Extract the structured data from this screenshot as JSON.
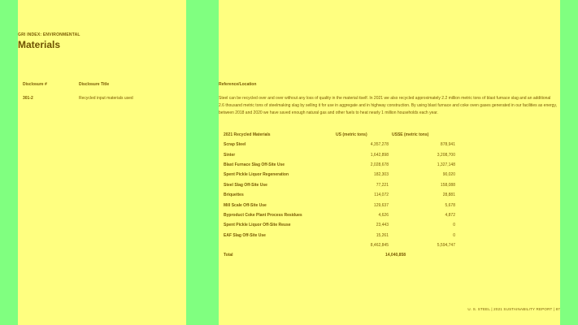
{
  "header": {
    "eyebrow": "GRI INDEX: ENVIRONMENTAL",
    "title": "Materials"
  },
  "columns": {
    "disclosure": "Disclosure #",
    "disclosure_title": "Disclosure Title",
    "reference": "Reference/Location"
  },
  "row": {
    "number": "301-2",
    "title": "Recycled input materials used",
    "description": "Steel can be recycled over and over without any loss of quality in the material itself. In 2021 we also recycled approximately 2.2 million metric tons of blast furnace slag and an additional 2.6 thousand metric tons of steelmaking slag by selling it for use in aggregate and in highway construction. By using blast furnace and coke oven gases generated in our facilities as energy, between 2018 and 2020 we have saved enough natural gas and other fuels to heat nearly 1 million households each year."
  },
  "table": {
    "headers": [
      "2021 Recycled Materials",
      "US (metric tons)",
      "USSE (metric tons)"
    ],
    "rows": [
      {
        "name": "Scrap Steel",
        "us": "4,357,278",
        "usse": "878,941"
      },
      {
        "name": "Sinter",
        "us": "1,642,898",
        "usse": "3,208,700"
      },
      {
        "name": "Blast Furnace Slag Off-Site Use",
        "us": "2,028,678",
        "usse": "1,327,148"
      },
      {
        "name": "Spent Pickle Liquor Regeneration",
        "us": "182,303",
        "usse": "90,020"
      },
      {
        "name": "Steel Slag Off-Site Use",
        "us": "77,221",
        "usse": "158,088"
      },
      {
        "name": "Briquettes",
        "us": "114,072",
        "usse": "28,881"
      },
      {
        "name": "Mill Scale Off-Site Use",
        "us": "129,637",
        "usse": "5,678"
      },
      {
        "name": "Byproduct Coke Plant Process Residues",
        "us": "4,626",
        "usse": "4,872"
      },
      {
        "name": "Spent Pickle Liquor Off-Site Reuse",
        "us": "23,443",
        "usse": "0"
      },
      {
        "name": "EAF Slag Off-Site Use",
        "us": "15,261",
        "usse": "0"
      }
    ],
    "subtotal_us": "8,462,845",
    "subtotal_usse": "5,594,747",
    "total_label": "Total",
    "total_value": "14,040,858"
  },
  "footer": "U. S. STEEL | 2021 SUSTAINABILITY REPORT | 87"
}
